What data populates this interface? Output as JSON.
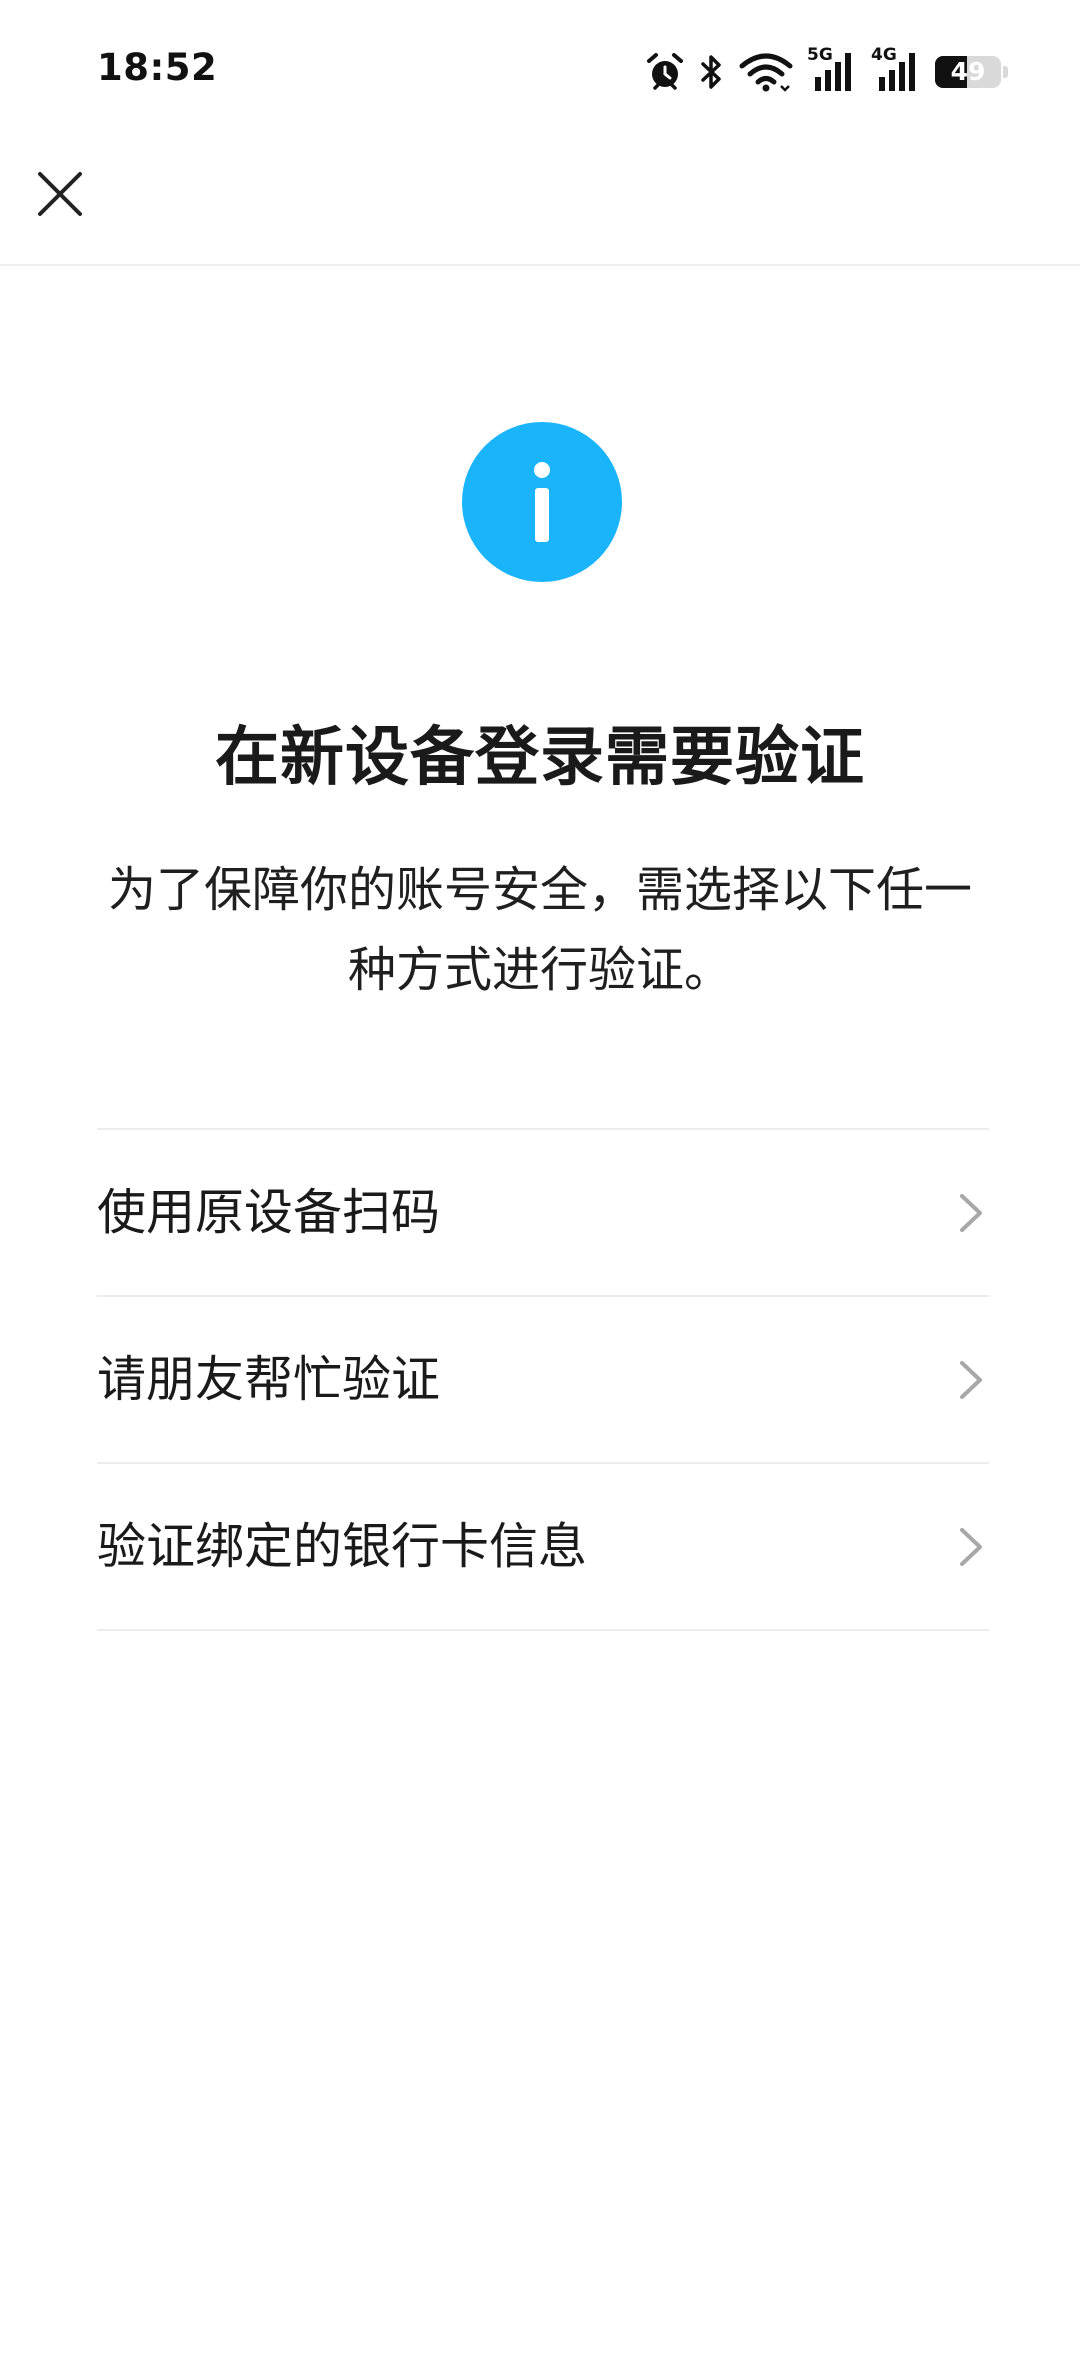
{
  "status_bar": {
    "time": "18:52",
    "network_1": "5G",
    "network_2": "4G",
    "battery_level": "49",
    "icons": [
      "alarm-icon",
      "bluetooth-icon",
      "wifi-icon",
      "signal-5g-icon",
      "signal-4g-icon",
      "battery-icon"
    ]
  },
  "nav": {
    "close_icon": "close-icon"
  },
  "main": {
    "icon": "info-icon",
    "icon_color": "#19b4fa",
    "title": "在新设备登录需要验证",
    "description": "为了保障你的账号安全，需选择以下任一种方式进行验证。",
    "options": [
      {
        "label": "使用原设备扫码",
        "icon": "chevron-right-icon"
      },
      {
        "label": "请朋友帮忙验证",
        "icon": "chevron-right-icon"
      },
      {
        "label": "验证绑定的银行卡信息",
        "icon": "chevron-right-icon"
      }
    ]
  }
}
